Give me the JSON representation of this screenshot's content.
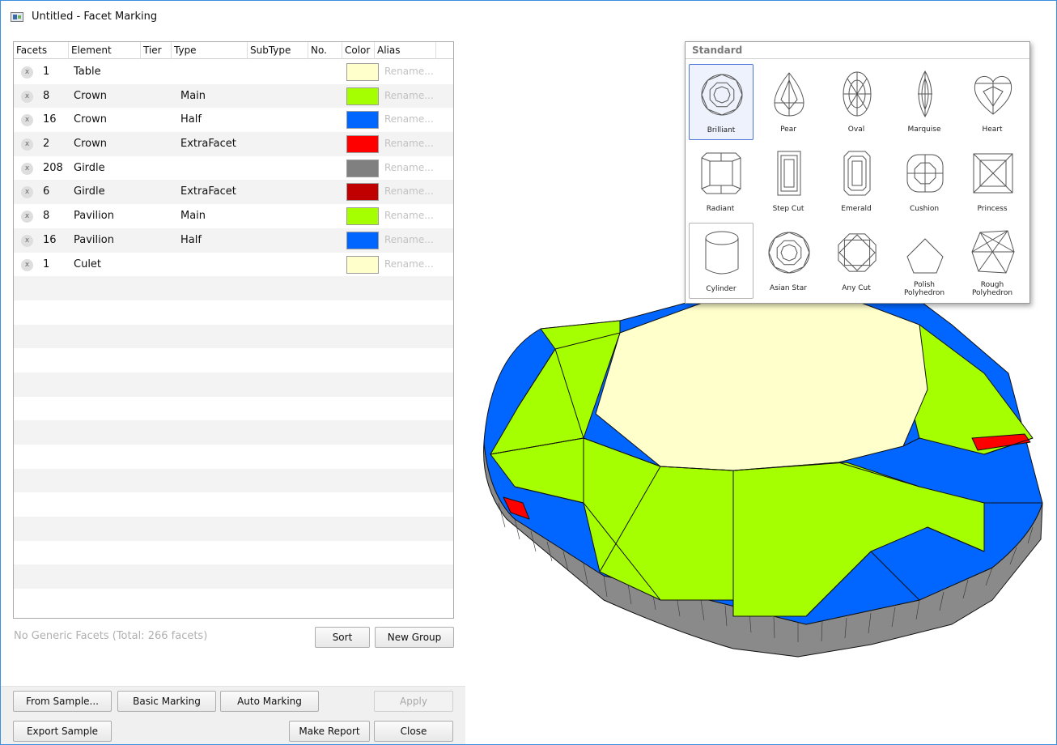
{
  "window": {
    "title": "Untitled - Facet Marking"
  },
  "table": {
    "columns": [
      "Facets",
      "Element",
      "Tier",
      "Type",
      "SubType",
      "No.",
      "Color",
      "Alias"
    ],
    "remove_glyph": "x",
    "rows": [
      {
        "facets": "1",
        "element": "Table",
        "tier": "",
        "type": "",
        "subtype": "",
        "no": "",
        "color": "#ffffcc",
        "alias": "Rename..."
      },
      {
        "facets": "8",
        "element": "Crown",
        "tier": "",
        "type": "Main",
        "subtype": "",
        "no": "",
        "color": "#a6ff00",
        "alias": "Rename..."
      },
      {
        "facets": "16",
        "element": "Crown",
        "tier": "",
        "type": "Half",
        "subtype": "",
        "no": "",
        "color": "#0066ff",
        "alias": "Rename..."
      },
      {
        "facets": "2",
        "element": "Crown",
        "tier": "",
        "type": "ExtraFacet",
        "subtype": "",
        "no": "",
        "color": "#ff0000",
        "alias": "Rename..."
      },
      {
        "facets": "208",
        "element": "Girdle",
        "tier": "",
        "type": "",
        "subtype": "",
        "no": "",
        "color": "#808080",
        "alias": "Rename..."
      },
      {
        "facets": "6",
        "element": "Girdle",
        "tier": "",
        "type": "ExtraFacet",
        "subtype": "",
        "no": "",
        "color": "#c00000",
        "alias": "Rename..."
      },
      {
        "facets": "8",
        "element": "Pavilion",
        "tier": "",
        "type": "Main",
        "subtype": "",
        "no": "",
        "color": "#a6ff00",
        "alias": "Rename..."
      },
      {
        "facets": "16",
        "element": "Pavilion",
        "tier": "",
        "type": "Half",
        "subtype": "",
        "no": "",
        "color": "#0066ff",
        "alias": "Rename..."
      },
      {
        "facets": "1",
        "element": "Culet",
        "tier": "",
        "type": "",
        "subtype": "",
        "no": "",
        "color": "#ffffcc",
        "alias": "Rename..."
      }
    ]
  },
  "footer": {
    "status": "No Generic Facets (Total: 266 facets)",
    "sort_label": "Sort",
    "new_group_label": "New Group"
  },
  "buttons": {
    "from_sample": "From Sample...",
    "basic_marking": "Basic Marking",
    "auto_marking": "Auto Marking",
    "apply": "Apply",
    "export_sample": "Export Sample",
    "make_report": "Make Report",
    "close": "Close"
  },
  "shape_popup": {
    "header": "Standard",
    "selected": "Brilliant",
    "shapes": [
      {
        "key": "brilliant",
        "label": "Brilliant"
      },
      {
        "key": "pear",
        "label": "Pear"
      },
      {
        "key": "oval",
        "label": "Oval"
      },
      {
        "key": "marquise",
        "label": "Marquise"
      },
      {
        "key": "heart",
        "label": "Heart"
      },
      {
        "key": "radiant",
        "label": "Radiant"
      },
      {
        "key": "step-cut",
        "label": "Step Cut"
      },
      {
        "key": "emerald",
        "label": "Emerald"
      },
      {
        "key": "cushion",
        "label": "Cushion"
      },
      {
        "key": "princess",
        "label": "Princess"
      },
      {
        "key": "cylinder",
        "label": "Cylinder"
      },
      {
        "key": "asian-star",
        "label": "Asian Star"
      },
      {
        "key": "any-cut",
        "label": "Any Cut"
      },
      {
        "key": "polish-polyhedron",
        "label": "Polish Polyhedron"
      },
      {
        "key": "rough-polyhedron",
        "label": "Rough Polyhedron"
      }
    ]
  },
  "viewport": {
    "colors": {
      "table": "#ffffcc",
      "main": "#a6ff00",
      "half": "#0066ff",
      "extra": "#ff0000",
      "girdle": "#808080"
    }
  }
}
